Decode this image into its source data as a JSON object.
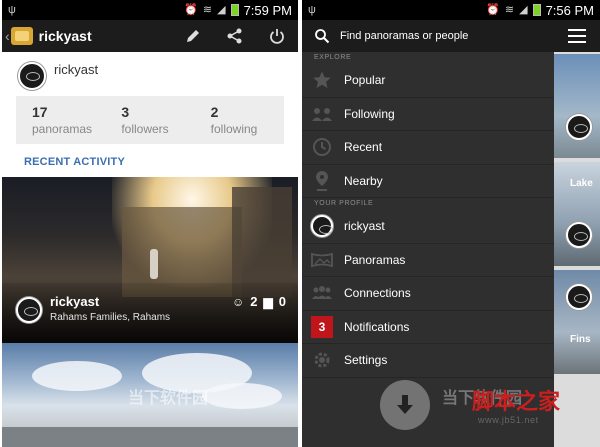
{
  "left_screen": {
    "status_bar": {
      "time": "7:59 PM"
    },
    "action_bar": {
      "title": "rickyast",
      "icons": [
        "back-icon",
        "app-logo",
        "edit-pencil-icon",
        "share-icon",
        "power-icon"
      ]
    },
    "profile": {
      "name": "rickyast",
      "stats": [
        {
          "value": "17",
          "label": "panoramas"
        },
        {
          "value": "3",
          "label": "followers"
        },
        {
          "value": "2",
          "label": "following"
        }
      ],
      "section_title": "RECENT ACTIVITY"
    },
    "activity": [
      {
        "user": "rickyast",
        "location": "Rahams  Families, Rahams",
        "likes": "2",
        "comments": "0"
      }
    ],
    "watermark": "当下软件园"
  },
  "right_screen": {
    "status_bar": {
      "time": "7:56 PM"
    },
    "search": {
      "placeholder": "Find panoramas or people"
    },
    "explore_header": "EXPLORE",
    "explore_items": [
      {
        "label": "Popular",
        "icon": "star-icon"
      },
      {
        "label": "Following",
        "icon": "people-icon"
      },
      {
        "label": "Recent",
        "icon": "clock-icon"
      },
      {
        "label": "Nearby",
        "icon": "location-pin-icon"
      }
    ],
    "profile_header": "YOUR PROFILE",
    "profile_items": [
      {
        "label": "rickyast",
        "icon": "avatar"
      },
      {
        "label": "Panoramas",
        "icon": "panorama-icon"
      },
      {
        "label": "Connections",
        "icon": "connections-icon"
      },
      {
        "label": "Notifications",
        "icon": "badge",
        "badge": "3"
      },
      {
        "label": "Settings",
        "icon": "gear-icon"
      }
    ],
    "behind_tiles": [
      "Lake",
      "Fins"
    ]
  },
  "site_watermark": {
    "logo": "脚本之家",
    "url": "www.jb51.net"
  }
}
